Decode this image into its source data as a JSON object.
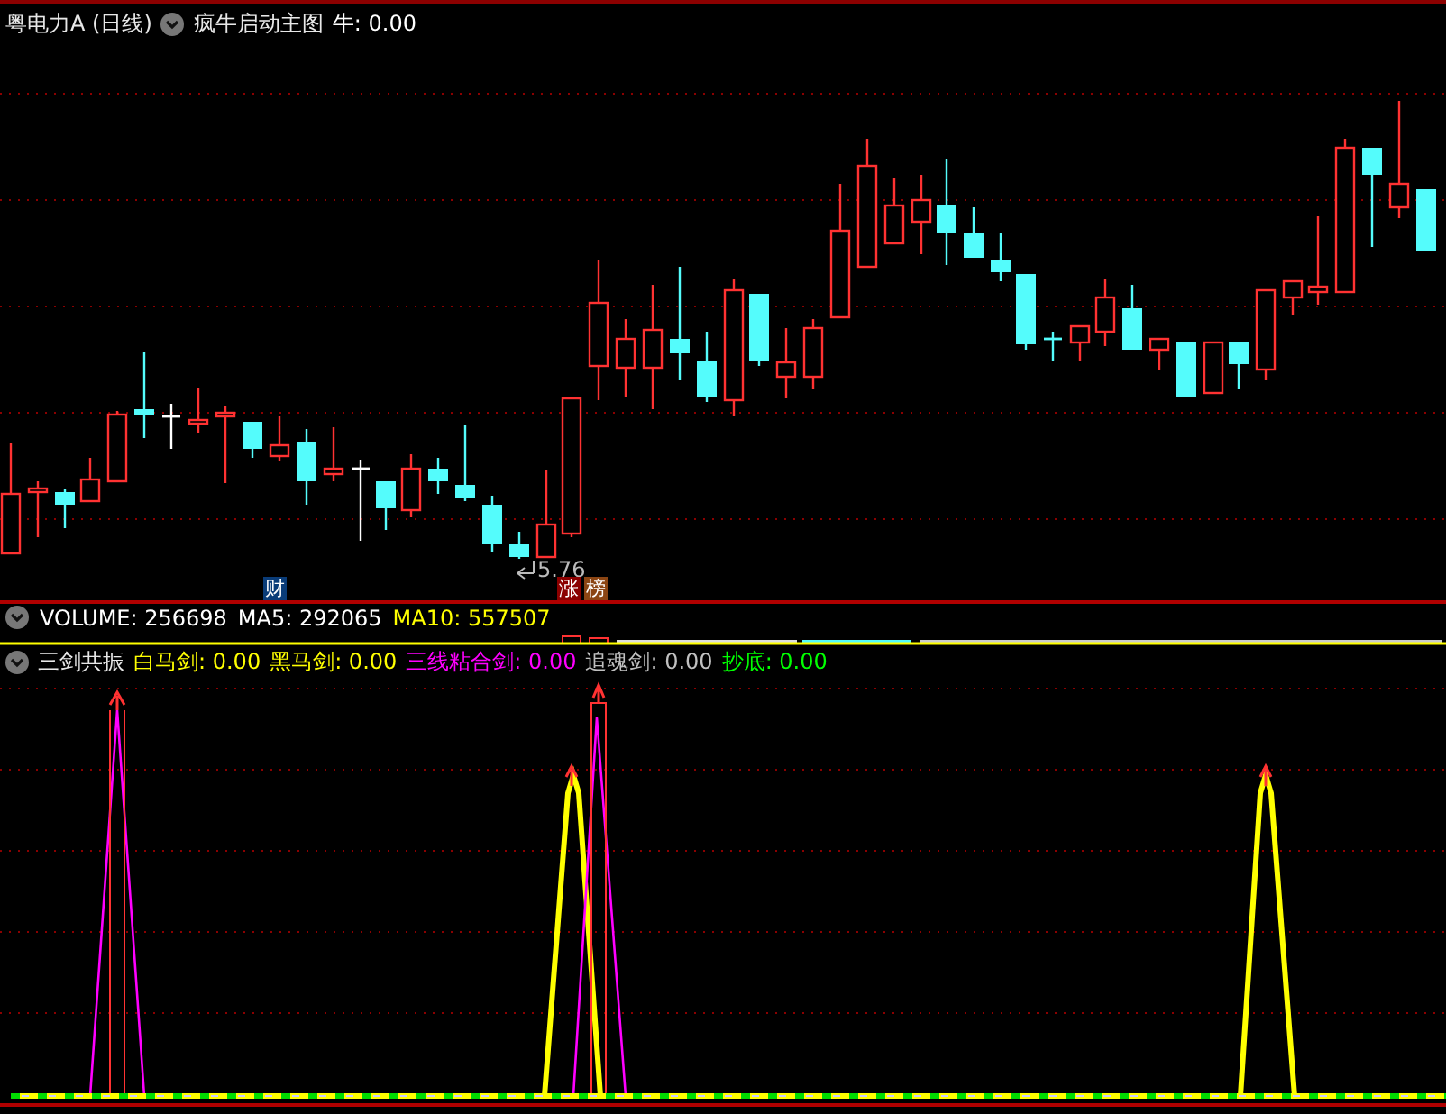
{
  "header": {
    "stock_title": "粤电力A (日线)",
    "indicator_name": "疯牛启动主图",
    "readings": [
      {
        "label": "牛:",
        "value": "0.00",
        "color": "#ffffff"
      }
    ]
  },
  "main_chart": {
    "price_label": "5.76",
    "badges": [
      {
        "text": "财",
        "color": "#0a3c78"
      },
      {
        "text": "涨",
        "color": "#8b0000"
      },
      {
        "text": "榜",
        "color": "#8b4513"
      }
    ]
  },
  "volume_panel": {
    "readings": [
      {
        "label": "VOLUME:",
        "value": "256698",
        "color": "#ffffff"
      },
      {
        "label": "MA5:",
        "value": "292065",
        "color": "#ffffff"
      },
      {
        "label": "MA10:",
        "value": "557507",
        "color": "#ffff00"
      }
    ]
  },
  "signal_panel": {
    "name": "三剑共振",
    "readings": [
      {
        "label": "白马剑:",
        "value": "0.00",
        "color": "#ffff00"
      },
      {
        "label": "黑马剑:",
        "value": "0.00",
        "color": "#ffff00"
      },
      {
        "label": "三线粘合剑:",
        "value": "0.00",
        "color": "#ff00ff"
      },
      {
        "label": "追魂剑:",
        "value": "0.00",
        "color": "#c0c0c0"
      },
      {
        "label": "抄底:",
        "value": "0.00",
        "color": "#00ff00"
      }
    ]
  }
}
